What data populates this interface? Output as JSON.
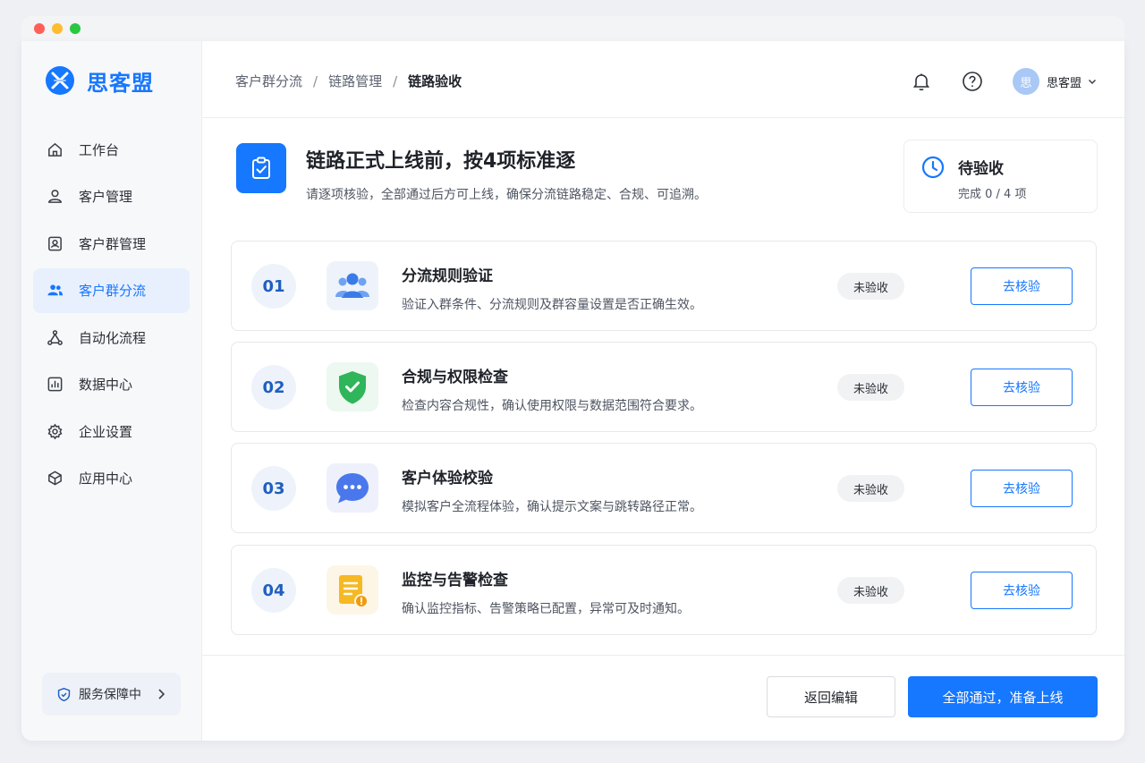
{
  "brand": {
    "name": "思客盟",
    "color": "#1677ff"
  },
  "sidebar": {
    "items": [
      {
        "label": "工作台",
        "icon": "home-icon",
        "active": false
      },
      {
        "label": "客户管理",
        "icon": "user-icon",
        "active": false
      },
      {
        "label": "客户群管理",
        "icon": "contact-card-icon",
        "active": false
      },
      {
        "label": "客户群分流",
        "icon": "users-icon",
        "active": true
      },
      {
        "label": "自动化流程",
        "icon": "flow-icon",
        "active": false
      },
      {
        "label": "数据中心",
        "icon": "chart-icon",
        "active": false
      },
      {
        "label": "企业设置",
        "icon": "gear-icon",
        "active": false
      },
      {
        "label": "应用中心",
        "icon": "app-box-icon",
        "active": false
      }
    ],
    "service": {
      "label": "服务保障中",
      "icon": "shield-icon"
    }
  },
  "header": {
    "breadcrumb": [
      "客户群分流",
      "链路管理",
      "链路验收"
    ],
    "separator": "/",
    "user": {
      "avatar_text": "思",
      "name": "思客盟"
    }
  },
  "hero": {
    "title": "链路正式上线前，按4项标准逐",
    "subtitle": "请逐项核验，全部通过后方可上线，确保分流链路稳定、合规、可追溯。"
  },
  "status": {
    "title": "待验收",
    "progress_text": "完成 0 / 4 项",
    "completed": 0,
    "total": 4
  },
  "checks": [
    {
      "num": "01",
      "title": "分流规则验证",
      "desc": "验证入群条件、分流规则及群容量设置是否正确生效。",
      "status": "未验收",
      "action": "去核验",
      "icon": "users-group-icon",
      "icon_bg": "#eef3fb"
    },
    {
      "num": "02",
      "title": "合规与权限检查",
      "desc": "检查内容合规性，确认使用权限与数据范围符合要求。",
      "status": "未验收",
      "action": "去核验",
      "icon": "shield-check-icon",
      "icon_bg": "#edf8f0"
    },
    {
      "num": "03",
      "title": "客户体验校验",
      "desc": "模拟客户全流程体验，确认提示文案与跳转路径正常。",
      "status": "未验收",
      "action": "去核验",
      "icon": "chat-bubble-icon",
      "icon_bg": "#eef1fb"
    },
    {
      "num": "04",
      "title": "监控与告警检查",
      "desc": "确认监控指标、告警策略已配置，异常可及时通知。",
      "status": "未验收",
      "action": "去核验",
      "icon": "document-alert-icon",
      "icon_bg": "#fdf6e6"
    }
  ],
  "footer": {
    "back_label": "返回编辑",
    "pass_label": "全部通过，准备上线"
  }
}
